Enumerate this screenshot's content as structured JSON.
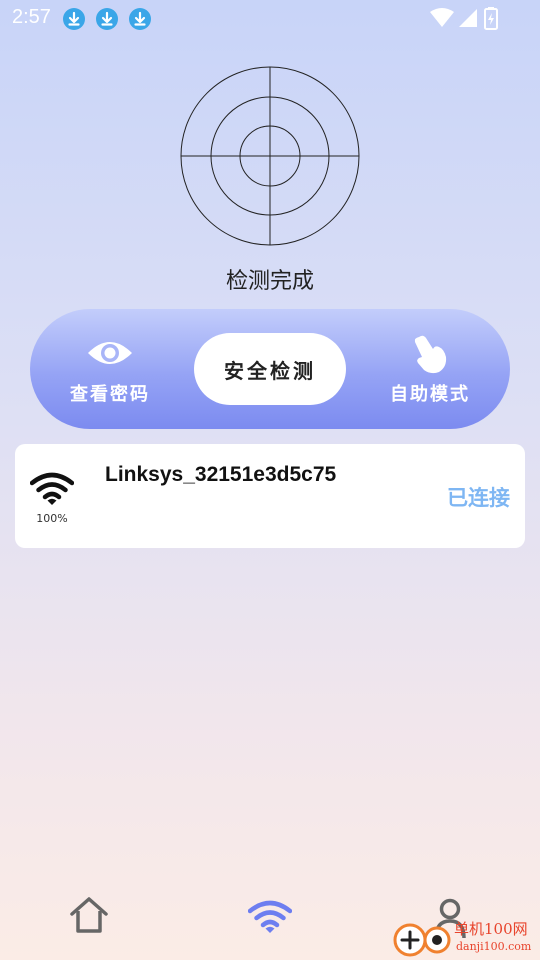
{
  "status_bar": {
    "time": "2:57",
    "notification_icons": [
      "download-icon",
      "download-icon",
      "download-icon"
    ],
    "right_icons": [
      "wifi-icon",
      "cell-signal-icon",
      "battery-charging-icon"
    ]
  },
  "radar": {
    "icon": "radar-icon",
    "status": "检测完成"
  },
  "modes": {
    "items": [
      {
        "label": "查看密码",
        "icon": "eye-icon"
      },
      {
        "label": "安全检测",
        "icon": "",
        "active": true
      },
      {
        "label": "自助模式",
        "icon": "hand-pointer-icon"
      }
    ]
  },
  "wifi_list": [
    {
      "ssid": "Linksys_32151e3d5c75",
      "signal": "100%",
      "status": "已连接",
      "icon": "wifi-signal-icon"
    }
  ],
  "bottom_nav": {
    "items": [
      {
        "icon": "home-icon",
        "active": false
      },
      {
        "icon": "wifi-icon",
        "active": true
      },
      {
        "icon": "user-icon",
        "active": false
      }
    ]
  },
  "watermark": {
    "text": "单机100网",
    "sub": "danji100.com"
  },
  "colors": {
    "accent": "#7b8af0",
    "connected": "#7eb6f3",
    "nav_active": "#6d7ef0",
    "nav_inactive": "#666666"
  }
}
